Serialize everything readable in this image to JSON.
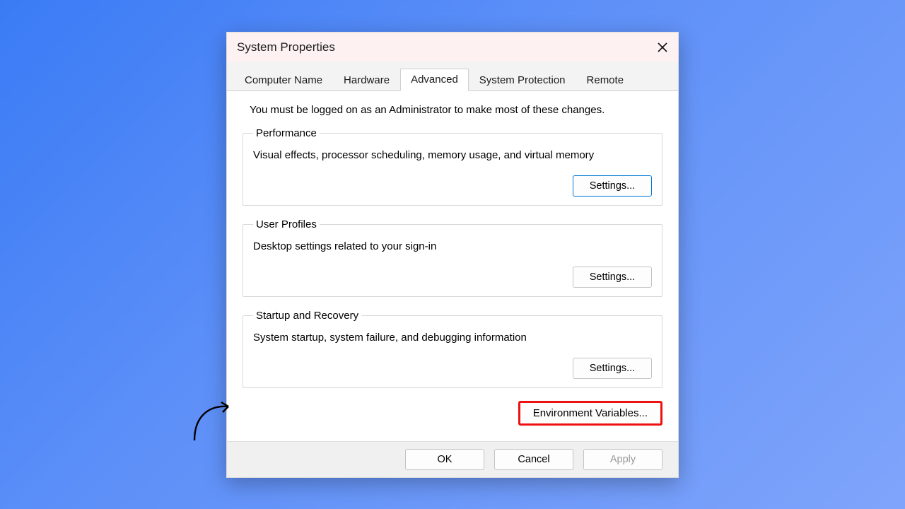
{
  "dialog": {
    "title": "System Properties",
    "admin_note": "You must be logged on as an Administrator to make most of these changes."
  },
  "tabs": {
    "computer_name": "Computer Name",
    "hardware": "Hardware",
    "advanced": "Advanced",
    "system_protection": "System Protection",
    "remote": "Remote"
  },
  "groups": {
    "performance": {
      "legend": "Performance",
      "desc": "Visual effects, processor scheduling, memory usage, and virtual memory",
      "button": "Settings..."
    },
    "user_profiles": {
      "legend": "User Profiles",
      "desc": "Desktop settings related to your sign-in",
      "button": "Settings..."
    },
    "startup_recovery": {
      "legend": "Startup and Recovery",
      "desc": "System startup, system failure, and debugging information",
      "button": "Settings..."
    }
  },
  "env_button": "Environment Variables...",
  "footer": {
    "ok": "OK",
    "cancel": "Cancel",
    "apply": "Apply"
  }
}
